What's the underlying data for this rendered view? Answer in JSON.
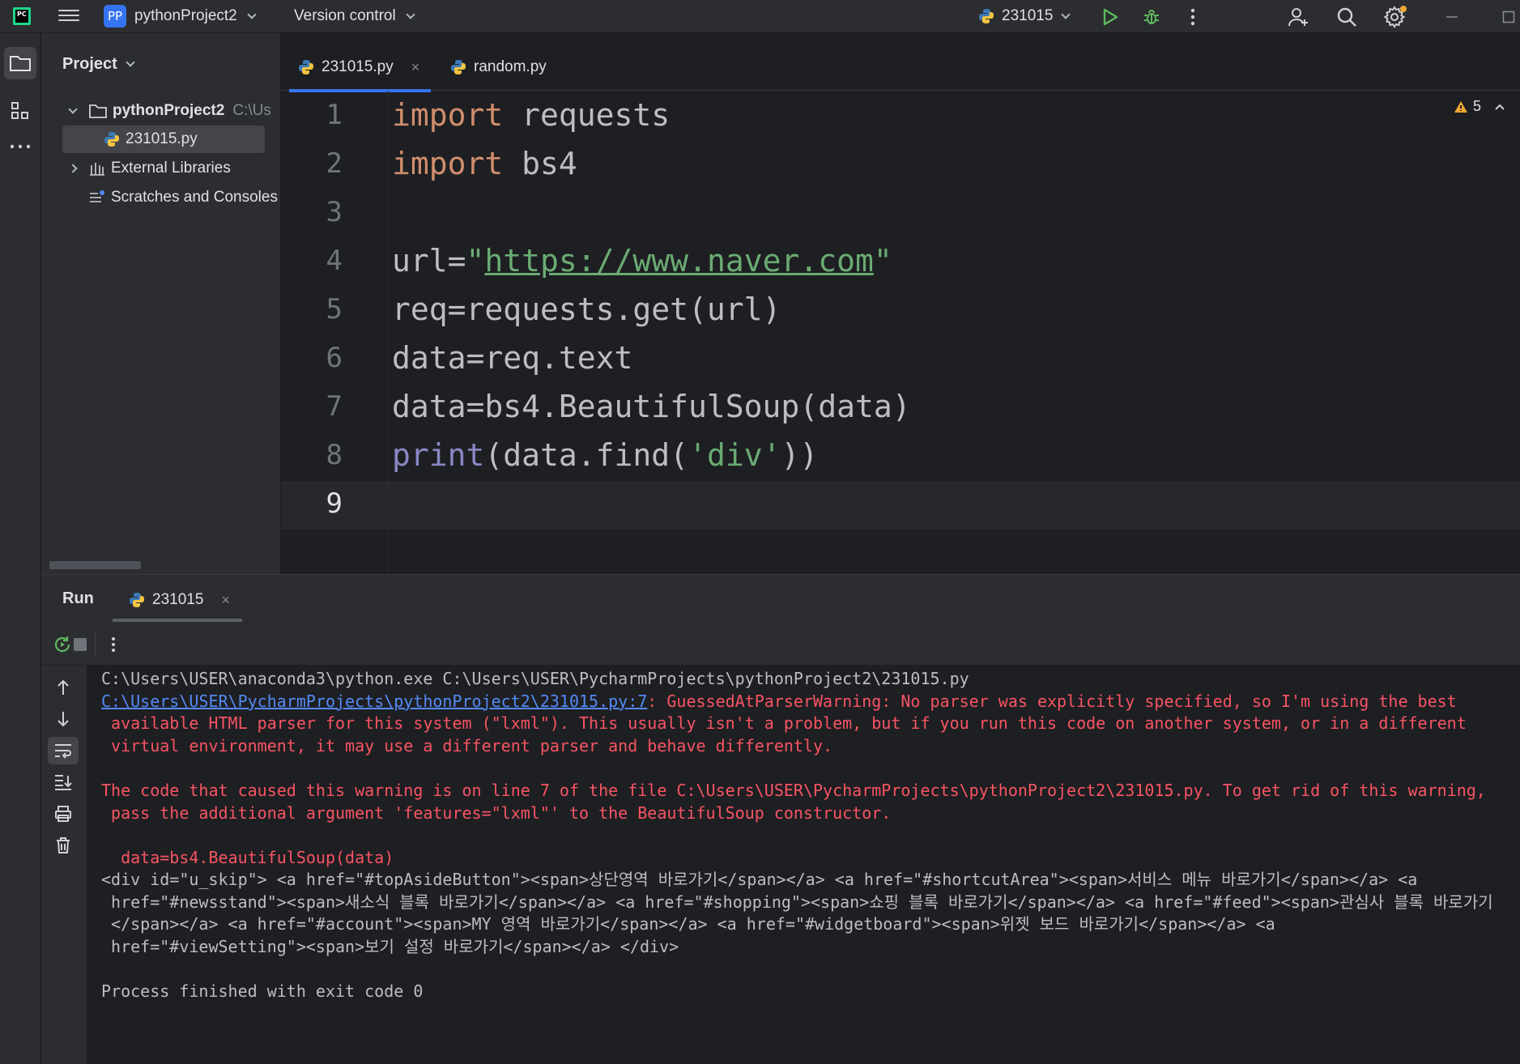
{
  "titlebar": {
    "logo": "PC",
    "project_badge": "PP",
    "project_name": "pythonProject2",
    "version_control": "Version control",
    "run_config": "231015"
  },
  "project_panel": {
    "header": "Project",
    "tree": {
      "root_name": "pythonProject2",
      "root_path": "C:\\Us",
      "file": "231015.py",
      "external": "External Libraries",
      "scratches": "Scratches and Consoles"
    }
  },
  "editor": {
    "tabs": [
      {
        "label": "231015.py",
        "active": true
      },
      {
        "label": "random.py",
        "active": false
      }
    ],
    "warnings_count": "5",
    "line_numbers": [
      "1",
      "2",
      "3",
      "4",
      "5",
      "6",
      "7",
      "8",
      "9"
    ],
    "lines": {
      "l1_kw": "import",
      "l1_rest": " requests",
      "l2_kw": "import",
      "l2_rest": " bs4",
      "l4_a": "url=",
      "l4_q1": "\"",
      "l4_url": "https://www.naver.com",
      "l4_q2": "\"",
      "l5": "req=requests.get(url)",
      "l6": "data=req.text",
      "l7": "data=bs4.BeautifulSoup(data)",
      "l8_fn": "print",
      "l8_a": "(data.find(",
      "l8_str": "'div'",
      "l8_b": "))"
    }
  },
  "run": {
    "title": "Run",
    "tab": "231015",
    "console": {
      "cmd": "C:\\Users\\USER\\anaconda3\\python.exe C:\\Users\\USER\\PycharmProjects\\pythonProject2\\231015.py",
      "link": "C:\\Users\\USER\\PycharmProjects\\pythonProject2\\231015.py:7",
      "warn1": ": GuessedAtParserWarning: No parser was explicitly specified, so I'm using the best",
      "warn2": " available HTML parser for this system (\"lxml\"). This usually isn't a problem, but if you run this code on another system, or in a different",
      "warn3": " virtual environment, it may use a different parser and behave differently.",
      "warn4": "The code that caused this warning is on line 7 of the file C:\\Users\\USER\\PycharmProjects\\pythonProject2\\231015.py. To get rid of this warning,",
      "warn5": " pass the additional argument 'features=\"lxml\"' to the BeautifulSoup constructor.",
      "warn6": "  data=bs4.BeautifulSoup(data)",
      "out1": "<div id=\"u_skip\"> <a href=\"#topAsideButton\"><span>상단영역 바로가기</span></a> <a href=\"#shortcutArea\"><span>서비스 메뉴 바로가기</span></a> <a",
      "out2": " href=\"#newsstand\"><span>새소식 블록 바로가기</span></a> <a href=\"#shopping\"><span>쇼핑 블록 바로가기</span></a> <a href=\"#feed\"><span>관심사 블록 바로가기",
      "out3": " </span></a> <a href=\"#account\"><span>MY 영역 바로가기</span></a> <a href=\"#widgetboard\"><span>위젯 보드 바로가기</span></a> <a",
      "out4": " href=\"#viewSetting\"><span>보기 설정 바로가기</span></a> </div>",
      "exit": "Process finished with exit code 0"
    }
  },
  "colors": {
    "keyword": "#cf8e6d",
    "string": "#6aab73",
    "builtin": "#8888c6",
    "error": "#f75464",
    "link": "#548af7",
    "accent": "#3574f0",
    "run_green": "#5fb85f",
    "debug_green": "#5fb85f"
  },
  "icons": [
    "pycharm-logo-icon",
    "hamburger-menu-icon",
    "python-file-icon",
    "run-icon",
    "debug-icon",
    "more-vertical-icon",
    "add-user-icon",
    "search-icon",
    "settings-icon",
    "minimize-icon",
    "maximize-icon",
    "folder-icon",
    "structure-icon",
    "more-horizontal-icon",
    "warning-icon",
    "rerun-icon",
    "stop-icon",
    "arrow-up-icon",
    "arrow-down-icon",
    "soft-wrap-icon",
    "scroll-to-end-icon",
    "print-icon",
    "trash-icon"
  ]
}
